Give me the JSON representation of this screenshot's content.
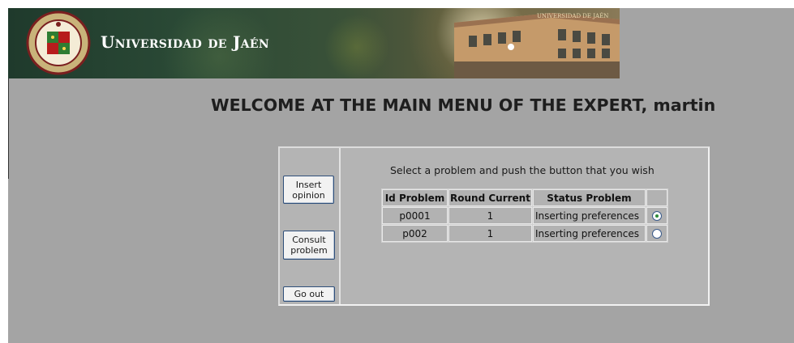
{
  "banner": {
    "university_name": "Universidad de Jaén",
    "seal_icon": "university-seal-icon",
    "building_sign": "UNIVERSIDAD DE JAÉN"
  },
  "heading": "WELCOME AT THE MAIN MENU OF THE EXPERT, martin",
  "actions": {
    "insert_opinion_line1": "Insert",
    "insert_opinion_line2": "opinion",
    "consult_problem_line1": "Consult",
    "consult_problem_line2": "problem",
    "go_out": "Go out"
  },
  "instruction": "Select a problem and push the button that you wish",
  "table": {
    "headers": [
      "Id Problem",
      "Round Current",
      "Status Problem",
      ""
    ],
    "rows": [
      {
        "id": "p0001",
        "round": "1",
        "status": "Inserting preferences",
        "selected": true
      },
      {
        "id": "p002",
        "round": "1",
        "status": "Inserting preferences",
        "selected": false
      }
    ]
  },
  "colors": {
    "page_background": "#a4a4a4",
    "panel_background": "#b4b4b4",
    "button_border": "#2f4f7a",
    "radio_selected": "#2e8b3a"
  }
}
